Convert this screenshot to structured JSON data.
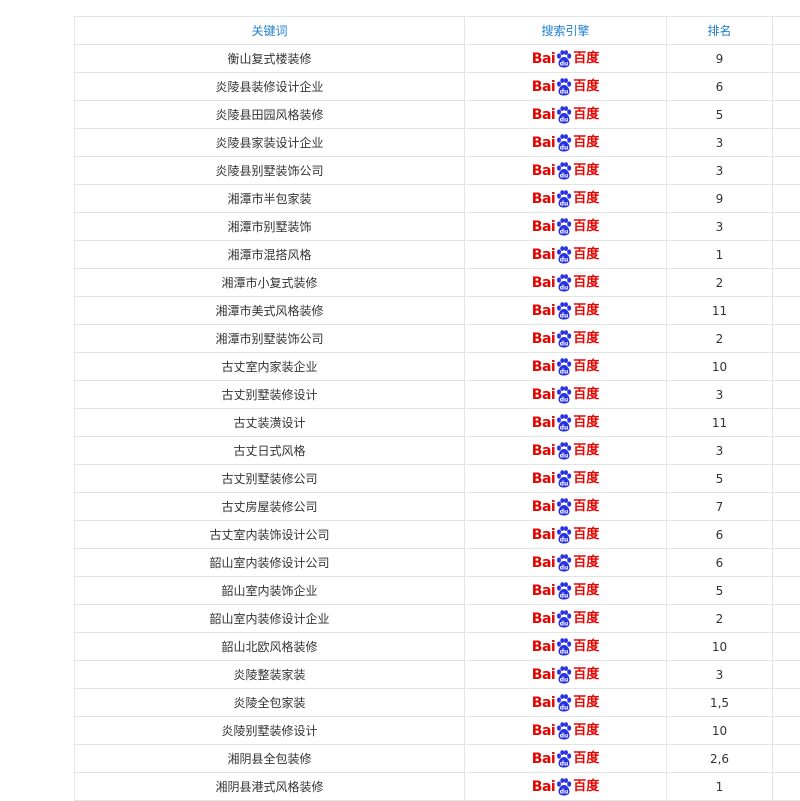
{
  "table": {
    "headers": {
      "keyword": "关键词",
      "engine": "搜索引擎",
      "rank": "排名",
      "extra": ""
    },
    "engine_logo": {
      "text_left": "Bai",
      "text_right": "百度",
      "icon": "baidu-paw-icon",
      "color": "#e10602"
    },
    "rows": [
      {
        "keyword": "衡山复式楼装修",
        "rank": "9"
      },
      {
        "keyword": "炎陵县装修设计企业",
        "rank": "6"
      },
      {
        "keyword": "炎陵县田园风格装修",
        "rank": "5"
      },
      {
        "keyword": "炎陵县家装设计企业",
        "rank": "3"
      },
      {
        "keyword": "炎陵县别墅装饰公司",
        "rank": "3"
      },
      {
        "keyword": "湘潭市半包家装",
        "rank": "9"
      },
      {
        "keyword": "湘潭市别墅装饰",
        "rank": "3"
      },
      {
        "keyword": "湘潭市混搭风格",
        "rank": "1"
      },
      {
        "keyword": "湘潭市小复式装修",
        "rank": "2"
      },
      {
        "keyword": "湘潭市美式风格装修",
        "rank": "11"
      },
      {
        "keyword": "湘潭市别墅装饰公司",
        "rank": "2"
      },
      {
        "keyword": "古丈室内家装企业",
        "rank": "10"
      },
      {
        "keyword": "古丈别墅装修设计",
        "rank": "3"
      },
      {
        "keyword": "古丈装潢设计",
        "rank": "11"
      },
      {
        "keyword": "古丈日式风格",
        "rank": "3"
      },
      {
        "keyword": "古丈别墅装修公司",
        "rank": "5"
      },
      {
        "keyword": "古丈房屋装修公司",
        "rank": "7"
      },
      {
        "keyword": "古丈室内装饰设计公司",
        "rank": "6"
      },
      {
        "keyword": "韶山室内装修设计公司",
        "rank": "6"
      },
      {
        "keyword": "韶山室内装饰企业",
        "rank": "5"
      },
      {
        "keyword": "韶山室内装修设计企业",
        "rank": "2"
      },
      {
        "keyword": "韶山北欧风格装修",
        "rank": "10"
      },
      {
        "keyword": "炎陵整装家装",
        "rank": "3"
      },
      {
        "keyword": "炎陵全包家装",
        "rank": "1,5"
      },
      {
        "keyword": "炎陵别墅装修设计",
        "rank": "10"
      },
      {
        "keyword": "湘阴县全包装修",
        "rank": "2,6"
      },
      {
        "keyword": "湘阴县港式风格装修",
        "rank": "1"
      }
    ]
  }
}
